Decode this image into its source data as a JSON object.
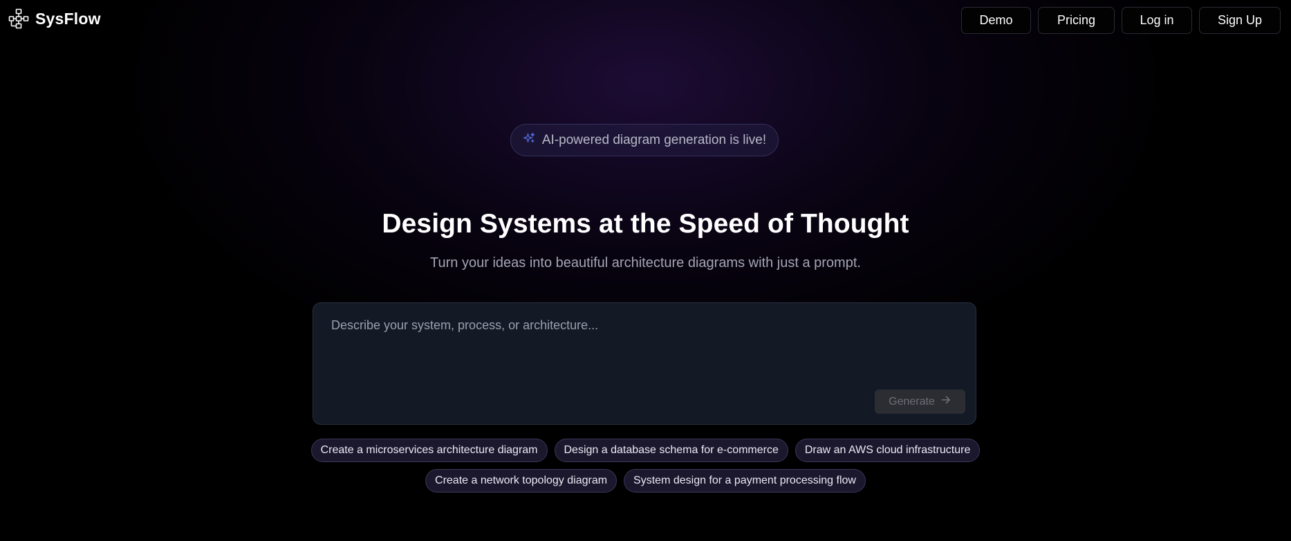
{
  "brand": {
    "name": "SysFlow",
    "logo_icon": "flow-diagram-icon"
  },
  "nav": {
    "demo": "Demo",
    "pricing": "Pricing",
    "login": "Log in",
    "signup": "Sign Up"
  },
  "announcement": {
    "icon": "sparkle-icon",
    "text": "AI-powered diagram generation is live!"
  },
  "hero": {
    "title": "Design Systems at the Speed of Thought",
    "subtitle": "Turn your ideas into beautiful architecture diagrams with just a prompt."
  },
  "prompt": {
    "value": "",
    "placeholder": "Describe your system, process, or architecture...",
    "generate_label": "Generate",
    "generate_icon": "arrow-right-icon",
    "generate_enabled": false
  },
  "suggestions": {
    "row1": [
      "Create a microservices architecture diagram",
      "Design a database schema for e-commerce",
      "Draw an AWS cloud infrastructure"
    ],
    "row2": [
      "Create a network topology diagram",
      "System design for a payment processing flow"
    ]
  },
  "colors": {
    "background": "#000000",
    "glow": "#261046",
    "accent_icon": "#4f6bd8",
    "prompt_bg": "#131a26",
    "chip_bg": "#201c36",
    "chip_border": "#3a3658"
  }
}
